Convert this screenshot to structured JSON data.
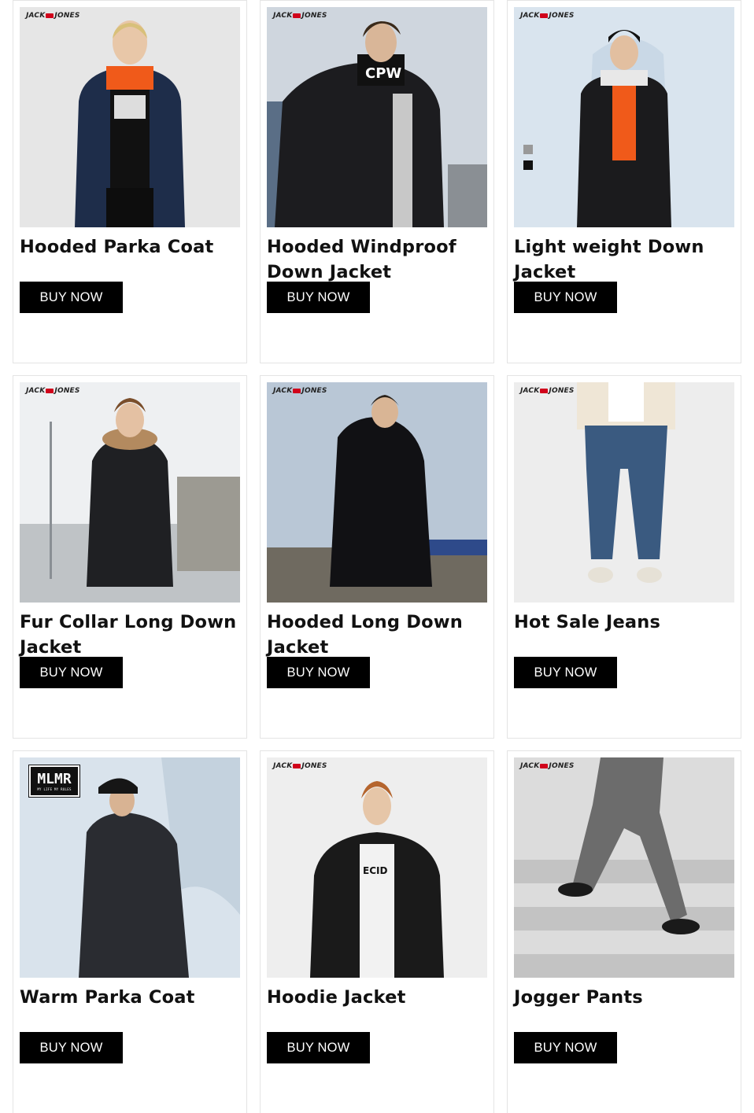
{
  "brand_text": {
    "left": "JACK",
    "right": "JONES"
  },
  "mlmr_logo": {
    "main": "MLMR",
    "tagline": "MY LIFE MY RULES"
  },
  "buy_label": "BUY NOW",
  "products": [
    {
      "title": "Hooded Parka Coat",
      "image": "model-navy-parka"
    },
    {
      "title": "Hooded Windproof Down Jacket",
      "image": "model-black-windproof-jacket"
    },
    {
      "title": "Light weight Down Jacket",
      "image": "model-puffer-jacket-ice"
    },
    {
      "title": "Fur Collar Long Down Jacket",
      "image": "model-fur-collar-parka"
    },
    {
      "title": "Hooded Long Down Jacket",
      "image": "model-long-puffer-river"
    },
    {
      "title": "Hot Sale Jeans",
      "image": "model-jeans"
    },
    {
      "title": "Warm Parka Coat",
      "image": "model-parka-mlmr"
    },
    {
      "title": "Hoodie Jacket",
      "image": "model-hoodie-jacket"
    },
    {
      "title": "Jogger Pants",
      "image": "model-jogger-pants-stairs"
    }
  ],
  "colors": {
    "button_bg": "#000000",
    "button_text": "#ffffff",
    "card_border": "#e4e4e4",
    "brand_accent": "#d0021b"
  }
}
